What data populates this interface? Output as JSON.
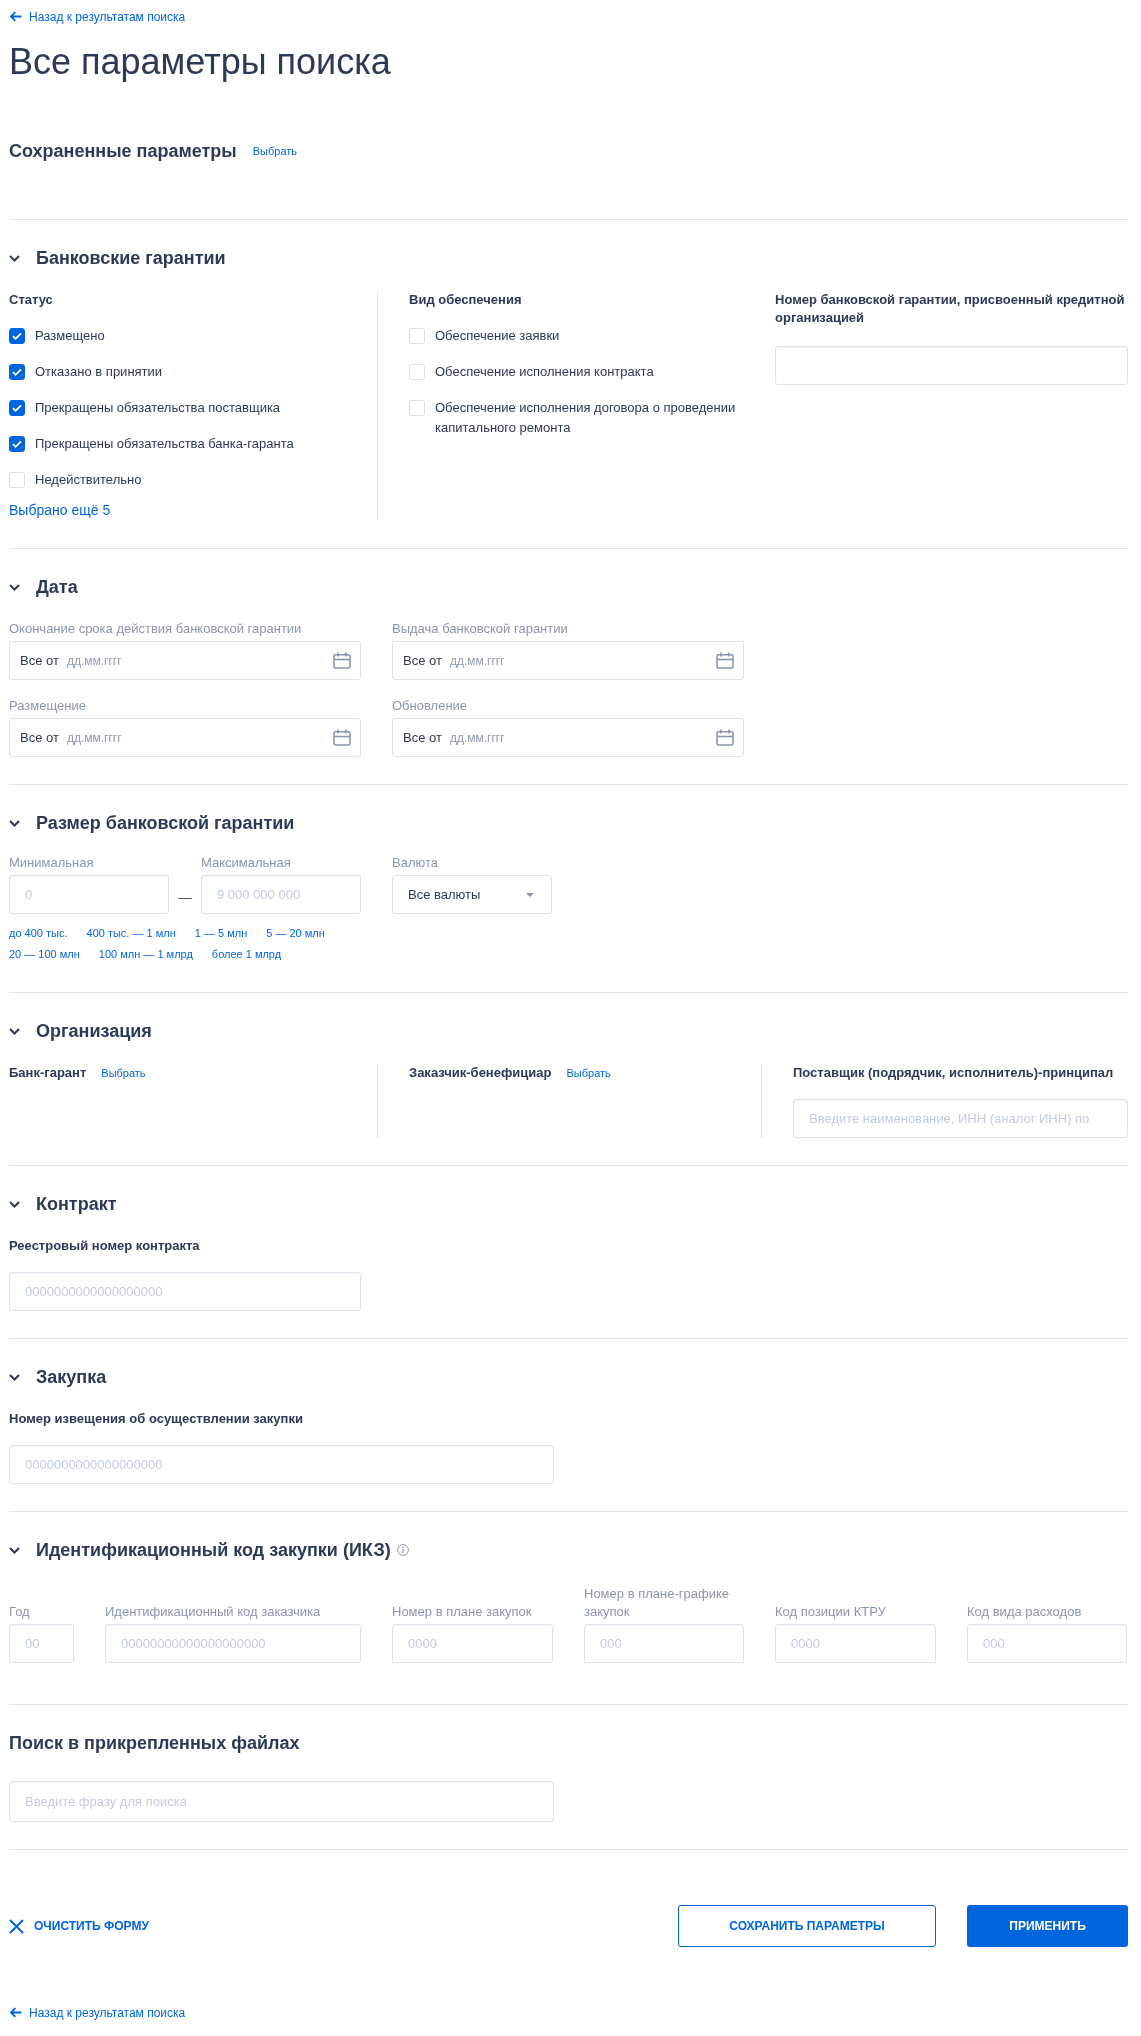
{
  "back_link": {
    "label": "Назад к результатам поиска"
  },
  "title": "Все параметры поиска",
  "saved_params": {
    "title": "Сохраненные параметры",
    "link": "Выбрать"
  },
  "sections": [
    {
      "kind": "guarantees",
      "title": "Банковские гарантии",
      "expanded": true,
      "status": {
        "label": "Статус",
        "options": [
          {
            "label": "Размещено",
            "checked": true
          },
          {
            "label": "Отказано в принятии",
            "checked": true
          },
          {
            "label": "Прекращены обязательства поставщика",
            "checked": true
          },
          {
            "label": "Прекращены обязательства банка-гаранта",
            "checked": true
          },
          {
            "label": "Недействительно",
            "checked": false
          }
        ],
        "more_link": "Выбрано ещё 5"
      },
      "security": {
        "label": "Вид обеспечения",
        "options": [
          {
            "label": "Обеспечение заявки",
            "checked": false
          },
          {
            "label": "Обеспечение исполнения контракта",
            "checked": false
          },
          {
            "label": "Обеспечение исполнения договора о проведении капитального ремонта",
            "checked": false
          }
        ]
      },
      "number": {
        "label": "Номер банковской гарантии, присвоенный кредитной организацией"
      }
    },
    {
      "kind": "dates",
      "title": "Дата",
      "expanded": true,
      "fields": [
        {
          "label": "Окончание срока действия банковской гарантии",
          "prefix": "Все от",
          "placeholder": "дд.мм.гггг"
        },
        {
          "label": "Выдача банковской гарантии",
          "prefix": "Все от",
          "placeholder": "дд.мм.гггг"
        },
        {
          "label": "Размещение",
          "prefix": "Все от",
          "placeholder": "дд.мм.гггг"
        },
        {
          "label": "Обновление",
          "prefix": "Все от",
          "placeholder": "дд.мм.гггг"
        }
      ]
    },
    {
      "kind": "amount",
      "title": "Размер банковской гарантии",
      "expanded": true,
      "min": {
        "label": "Минимальная",
        "placeholder": "0"
      },
      "separator": "—",
      "max": {
        "label": "Максимальная",
        "placeholder": "9 000 000 000"
      },
      "currency": {
        "label": "Валюта",
        "value": "Все валюты"
      },
      "presets": [
        [
          "до 400 тыс.",
          "400 тыс. — 1 млн",
          "1 — 5 млн",
          "5 — 20 млн"
        ],
        [
          "20 — 100 млн",
          "100 млн — 1 млрд",
          "более 1 млрд"
        ]
      ]
    },
    {
      "kind": "organizations",
      "title": "Организация",
      "expanded": true,
      "columns": [
        {
          "kind": "picker",
          "label": "Банк-гарант",
          "link": "Выбрать"
        },
        {
          "kind": "picker",
          "label": "Заказчик-бенефициар",
          "link": "Выбрать"
        },
        {
          "kind": "input",
          "label": "Поставщик (подрядчик, исполнитель)-принципал",
          "placeholder": "Введите наименование, ИНН (аналог ИНН) по"
        }
      ]
    },
    {
      "kind": "contract",
      "title": "Контракт",
      "expanded": true,
      "field": {
        "label": "Реестровый номер контракта",
        "placeholder": "0000000000000000000"
      }
    },
    {
      "kind": "purchase",
      "title": "Закупка",
      "expanded": true,
      "field": {
        "label": "Номер извещения об осуществлении закупки",
        "placeholder": "0000000000000000000"
      }
    },
    {
      "kind": "ikz",
      "title": "Идентификационный код закупки (ИКЗ)",
      "expanded": true,
      "fields": [
        {
          "label": "Год",
          "placeholder": "00"
        },
        {
          "label": "Идентификационный код заказчика",
          "placeholder": "00000000000000000000"
        },
        {
          "label": "Номер в плане закупок",
          "placeholder": "0000"
        },
        {
          "label": "Номер в плане-графике закупок",
          "placeholder": "000"
        },
        {
          "label": "Код позиции КТРУ",
          "placeholder": "0000"
        },
        {
          "label": "Код вида расходов",
          "placeholder": "000"
        }
      ]
    },
    {
      "kind": "files",
      "title": "Поиск в прикрепленных файлах",
      "field": {
        "placeholder": "Введите фразу для поиска"
      }
    }
  ],
  "footer": {
    "clear": "ОЧИСТИТЬ ФОРМУ",
    "save": "СОХРАНИТЬ ПАРАМЕТРЫ",
    "apply": "ПРИМЕНИТЬ"
  },
  "bottom_back_link": {
    "label": "Назад к результатам поиска"
  }
}
